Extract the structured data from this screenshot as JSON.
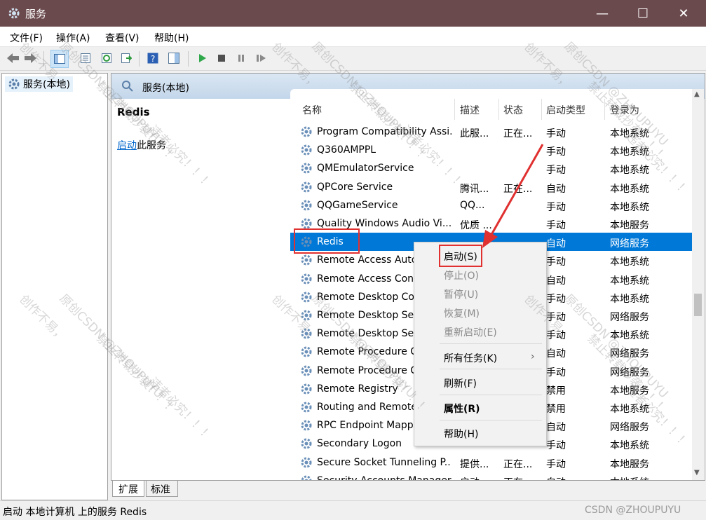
{
  "window": {
    "title": "服务",
    "icon": "gear-icon",
    "title_bg": "#6b4a4d"
  },
  "menu": [
    "文件(F)",
    "操作(A)",
    "查看(V)",
    "帮助(H)"
  ],
  "tree": {
    "root_label": "服务(本地)"
  },
  "main": {
    "header_title": "服务(本地)",
    "detail": {
      "service_name": "Redis",
      "start_link": "启动",
      "start_suffix": "此服务"
    },
    "columns": [
      "名称",
      "描述",
      "状态",
      "启动类型",
      "登录为"
    ],
    "rows": [
      {
        "name": "Program Compatibility Assi...",
        "desc": "此服...",
        "status": "正在...",
        "startup": "手动",
        "logon": "本地系统"
      },
      {
        "name": "Q360AMPPL",
        "desc": "",
        "status": "",
        "startup": "手动",
        "logon": "本地系统"
      },
      {
        "name": "QMEmulatorService",
        "desc": "",
        "status": "",
        "startup": "手动",
        "logon": "本地系统"
      },
      {
        "name": "QPCore Service",
        "desc": "腾讯...",
        "status": "正在...",
        "startup": "自动",
        "logon": "本地系统"
      },
      {
        "name": "QQGameService",
        "desc": "QQ...",
        "status": "",
        "startup": "手动",
        "logon": "本地系统"
      },
      {
        "name": "Quality Windows Audio Vi...",
        "desc": "优质 ...",
        "status": "",
        "startup": "手动",
        "logon": "本地服务"
      },
      {
        "name": "Redis",
        "desc": "",
        "status": "",
        "startup": "自动",
        "logon": "网络服务"
      },
      {
        "name": "Remote Access Auto",
        "desc": "",
        "status": "",
        "startup": "手动",
        "logon": "本地系统"
      },
      {
        "name": "Remote Access Con",
        "desc": "",
        "status": "",
        "startup": "自动",
        "logon": "本地系统"
      },
      {
        "name": "Remote Desktop Co",
        "desc": "",
        "status": "",
        "startup": "手动",
        "logon": "本地系统"
      },
      {
        "name": "Remote Desktop Se",
        "desc": "",
        "status": "",
        "startup": "手动",
        "logon": "网络服务"
      },
      {
        "name": "Remote Desktop Se",
        "desc": "",
        "status": "",
        "startup": "手动",
        "logon": "本地系统"
      },
      {
        "name": "Remote Procedure C",
        "desc": "",
        "status": "",
        "startup": "自动",
        "logon": "网络服务"
      },
      {
        "name": "Remote Procedure C",
        "desc": "",
        "status": "",
        "startup": "手动",
        "logon": "网络服务"
      },
      {
        "name": "Remote Registry",
        "desc": "",
        "status": "",
        "startup": "禁用",
        "logon": "本地服务"
      },
      {
        "name": "Routing and Remote",
        "desc": "",
        "status": "",
        "startup": "禁用",
        "logon": "本地系统"
      },
      {
        "name": "RPC Endpoint Mappe",
        "desc": "",
        "status": "",
        "startup": "自动",
        "logon": "网络服务"
      },
      {
        "name": "Secondary Logon",
        "desc": "",
        "status": "",
        "startup": "手动",
        "logon": "本地系统"
      },
      {
        "name": "Secure Socket Tunneling P...",
        "desc": "提供...",
        "status": "正在...",
        "startup": "手动",
        "logon": "本地服务"
      },
      {
        "name": "Security Accounts Manager",
        "desc": "启动...",
        "status": "正在...",
        "startup": "自动",
        "logon": "本地系统"
      }
    ],
    "selected_index": 6
  },
  "context_menu": {
    "start": "启动(S)",
    "stop": "停止(O)",
    "pause": "暂停(U)",
    "resume": "恢复(M)",
    "restart": "重新启动(E)",
    "all_tasks": "所有任务(K)",
    "refresh": "刷新(F)",
    "properties": "属性(R)",
    "help": "帮助(H)"
  },
  "tabs": [
    "扩展",
    "标准"
  ],
  "status_text": "启动 本地计算机 上的服务 Redis",
  "csdn_mark": "CSDN @ZHOUPUYU",
  "watermark": {
    "line1": "创作不易，",
    "line2": "原创CSDN @ZHOUPUYU",
    "line3": "禁止转载抄袭！！！",
    "line4": "违者必究！！！"
  },
  "colors": {
    "selection": "#0078d7",
    "annotation": "#e03030",
    "header_gradient": "#c3d6ea"
  }
}
